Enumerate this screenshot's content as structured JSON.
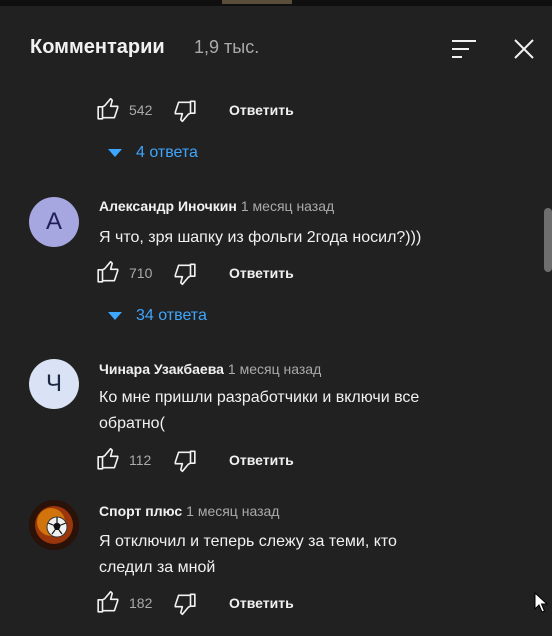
{
  "header": {
    "title": "Комментарии",
    "count": "1,9 тыс."
  },
  "top_actions": {
    "likes": "542",
    "reply": "Ответить"
  },
  "top_replies": {
    "label": "4 ответа"
  },
  "comments": [
    {
      "avatar_letter": "А",
      "avatar_color": "#a6a6e0",
      "author": "Александр Иночкин",
      "time": "1 месяц назад",
      "text_lines": [
        "Я что, зря шапку из фольги 2года носил?)))"
      ],
      "likes": "710",
      "reply": "Ответить",
      "replies": "34 ответа"
    },
    {
      "avatar_letter": "Ч",
      "avatar_color": "#d9e3f5",
      "author": "Чинара Узакбаева",
      "time": "1 месяц назад",
      "text_lines": [
        "Ко мне пришли разработчики и включи все",
        "обратно("
      ],
      "likes": "112",
      "reply": "Ответить"
    },
    {
      "avatar_icon": "soccer-ball-fire-icon",
      "author": "Спорт плюс",
      "time": "1 месяц назад",
      "text_lines": [
        "Я отключил и теперь слежу за теми, кто",
        "следил за мной"
      ],
      "likes": "182",
      "reply": "Ответить"
    }
  ],
  "colors": {
    "background": "#212121",
    "link_blue": "#3ea6ff",
    "secondary_text": "#aaaaaa"
  }
}
